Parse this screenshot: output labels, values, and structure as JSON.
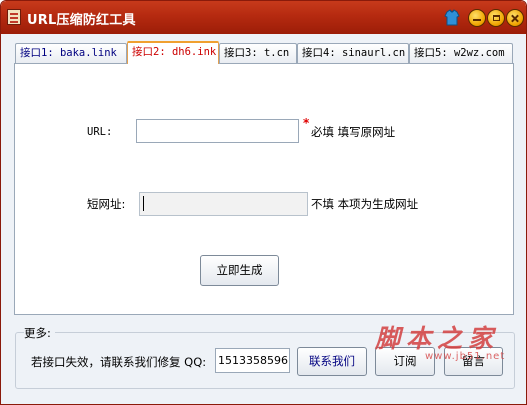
{
  "window": {
    "title": "URL压缩防红工具"
  },
  "tabs": [
    {
      "label": "接口1: baka.link"
    },
    {
      "label": "接口2: dh6.ink"
    },
    {
      "label": "接口3: t.cn"
    },
    {
      "label": "接口4: sinaurl.cn"
    },
    {
      "label": "接口5: w2wz.com"
    }
  ],
  "active_tab": 1,
  "form": {
    "url_label": "URL:",
    "url_value": "",
    "required_mark": "*",
    "url_note": "必填  填写原网址",
    "short_label": "短网址:",
    "short_value": "",
    "short_note": "不填  本项为生成网址",
    "generate_label": "立即生成"
  },
  "more": {
    "title": "更多:",
    "help_text": "若接口失效，请联系我们修复 QQ:",
    "qq": "1513358596",
    "contact_label": "联系我们",
    "subscribe_label": "订阅",
    "message_label": "留言"
  },
  "watermark": {
    "text": "脚本之家",
    "url": "www.jb51.net"
  },
  "colors": {
    "titlebar": "#b52a10",
    "active_tab_text": "#cc0000",
    "required": "#e00000"
  }
}
